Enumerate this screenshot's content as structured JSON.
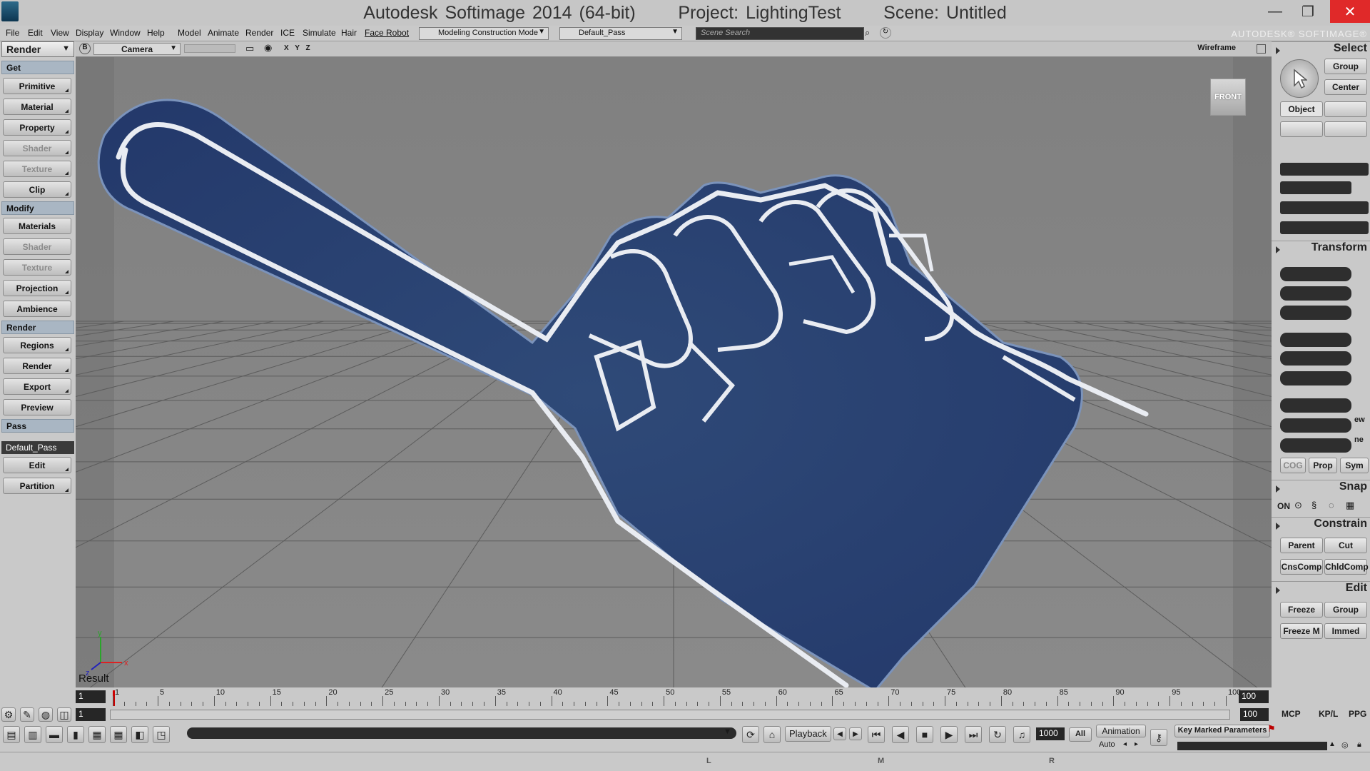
{
  "window": {
    "title": "Autodesk Softimage 2014 (64-bit)      Project: LightingTest      Scene: Untitled",
    "minimize": "—",
    "maximize": "❐",
    "close": "✕"
  },
  "menubar": {
    "items": [
      "File",
      "Edit",
      "View",
      "Display",
      "Window",
      "Help",
      "Model",
      "Animate",
      "Render",
      "ICE",
      "Simulate",
      "Hair",
      "Face Robot"
    ],
    "mode_dropdown": "Modeling Construction Mode",
    "pass_dropdown": "Default_Pass",
    "search_placeholder": "Scene Search",
    "brand": "AUTODESK® SOFTIMAGE®"
  },
  "left_panel": {
    "title": "Render",
    "sections": [
      {
        "header": "Get",
        "buttons": [
          {
            "label": "Primitive",
            "enabled": true
          },
          {
            "label": "Material",
            "enabled": true
          },
          {
            "label": "Property",
            "enabled": true
          },
          {
            "label": "Shader",
            "enabled": false
          },
          {
            "label": "Texture",
            "enabled": false
          },
          {
            "label": "Clip",
            "enabled": true
          }
        ]
      },
      {
        "header": "Modify",
        "buttons": [
          {
            "label": "Materials",
            "enabled": true
          },
          {
            "label": "Shader",
            "enabled": false
          },
          {
            "label": "Texture",
            "enabled": false
          },
          {
            "label": "Projection",
            "enabled": true
          },
          {
            "label": "Ambience",
            "enabled": true
          }
        ]
      },
      {
        "header": "Render",
        "buttons": [
          {
            "label": "Regions",
            "enabled": true
          },
          {
            "label": "Render",
            "enabled": true
          },
          {
            "label": "Export",
            "enabled": true
          },
          {
            "label": "Preview",
            "enabled": true
          }
        ]
      },
      {
        "header": "Pass",
        "buttons": [
          {
            "label": "Edit",
            "enabled": true
          },
          {
            "label": "Partition",
            "enabled": true
          }
        ]
      }
    ],
    "current_pass": "Default_Pass"
  },
  "viewport": {
    "letter": "B",
    "camera": "Camera",
    "axes_label": "X Y Z",
    "display_mode": "Wireframe",
    "view_cube": "FRONT",
    "label": "Result",
    "axis_x": "x",
    "axis_y": "y",
    "axis_z": "z"
  },
  "right_panel": {
    "select": {
      "title": "Select",
      "group": "Group",
      "center": "Center",
      "object": "Object"
    },
    "transform": {
      "title": "Transform",
      "cog": "COG",
      "prop": "Prop",
      "sym": "Sym",
      "view": "ew",
      "plane": "ne"
    },
    "snap": {
      "title": "Snap",
      "on": "ON"
    },
    "constrain": {
      "title": "Constrain",
      "parent": "Parent",
      "cut": "Cut",
      "cnscomp": "CnsComp",
      "chldcomp": "ChldComp"
    },
    "edit": {
      "title": "Edit",
      "freeze": "Freeze",
      "group": "Group",
      "freeze_m": "Freeze M",
      "immed": "Immed"
    }
  },
  "timeline": {
    "start": "1",
    "end": "100",
    "current_frame": "1",
    "range_end": "100",
    "ticks": [
      1,
      5,
      10,
      15,
      20,
      25,
      30,
      35,
      40,
      45,
      50,
      55,
      60,
      65,
      70,
      75,
      80,
      85,
      90,
      95,
      100
    ]
  },
  "playback": {
    "label": "Playback",
    "frame": "1000",
    "all": "All",
    "animation": "Animation",
    "auto": "Auto",
    "key_marked": "Key Marked Parameters"
  },
  "bottom_tabs": [
    "MCP",
    "KP/L",
    "PPG"
  ],
  "status": {
    "l": "L",
    "m": "M",
    "r": "R"
  }
}
